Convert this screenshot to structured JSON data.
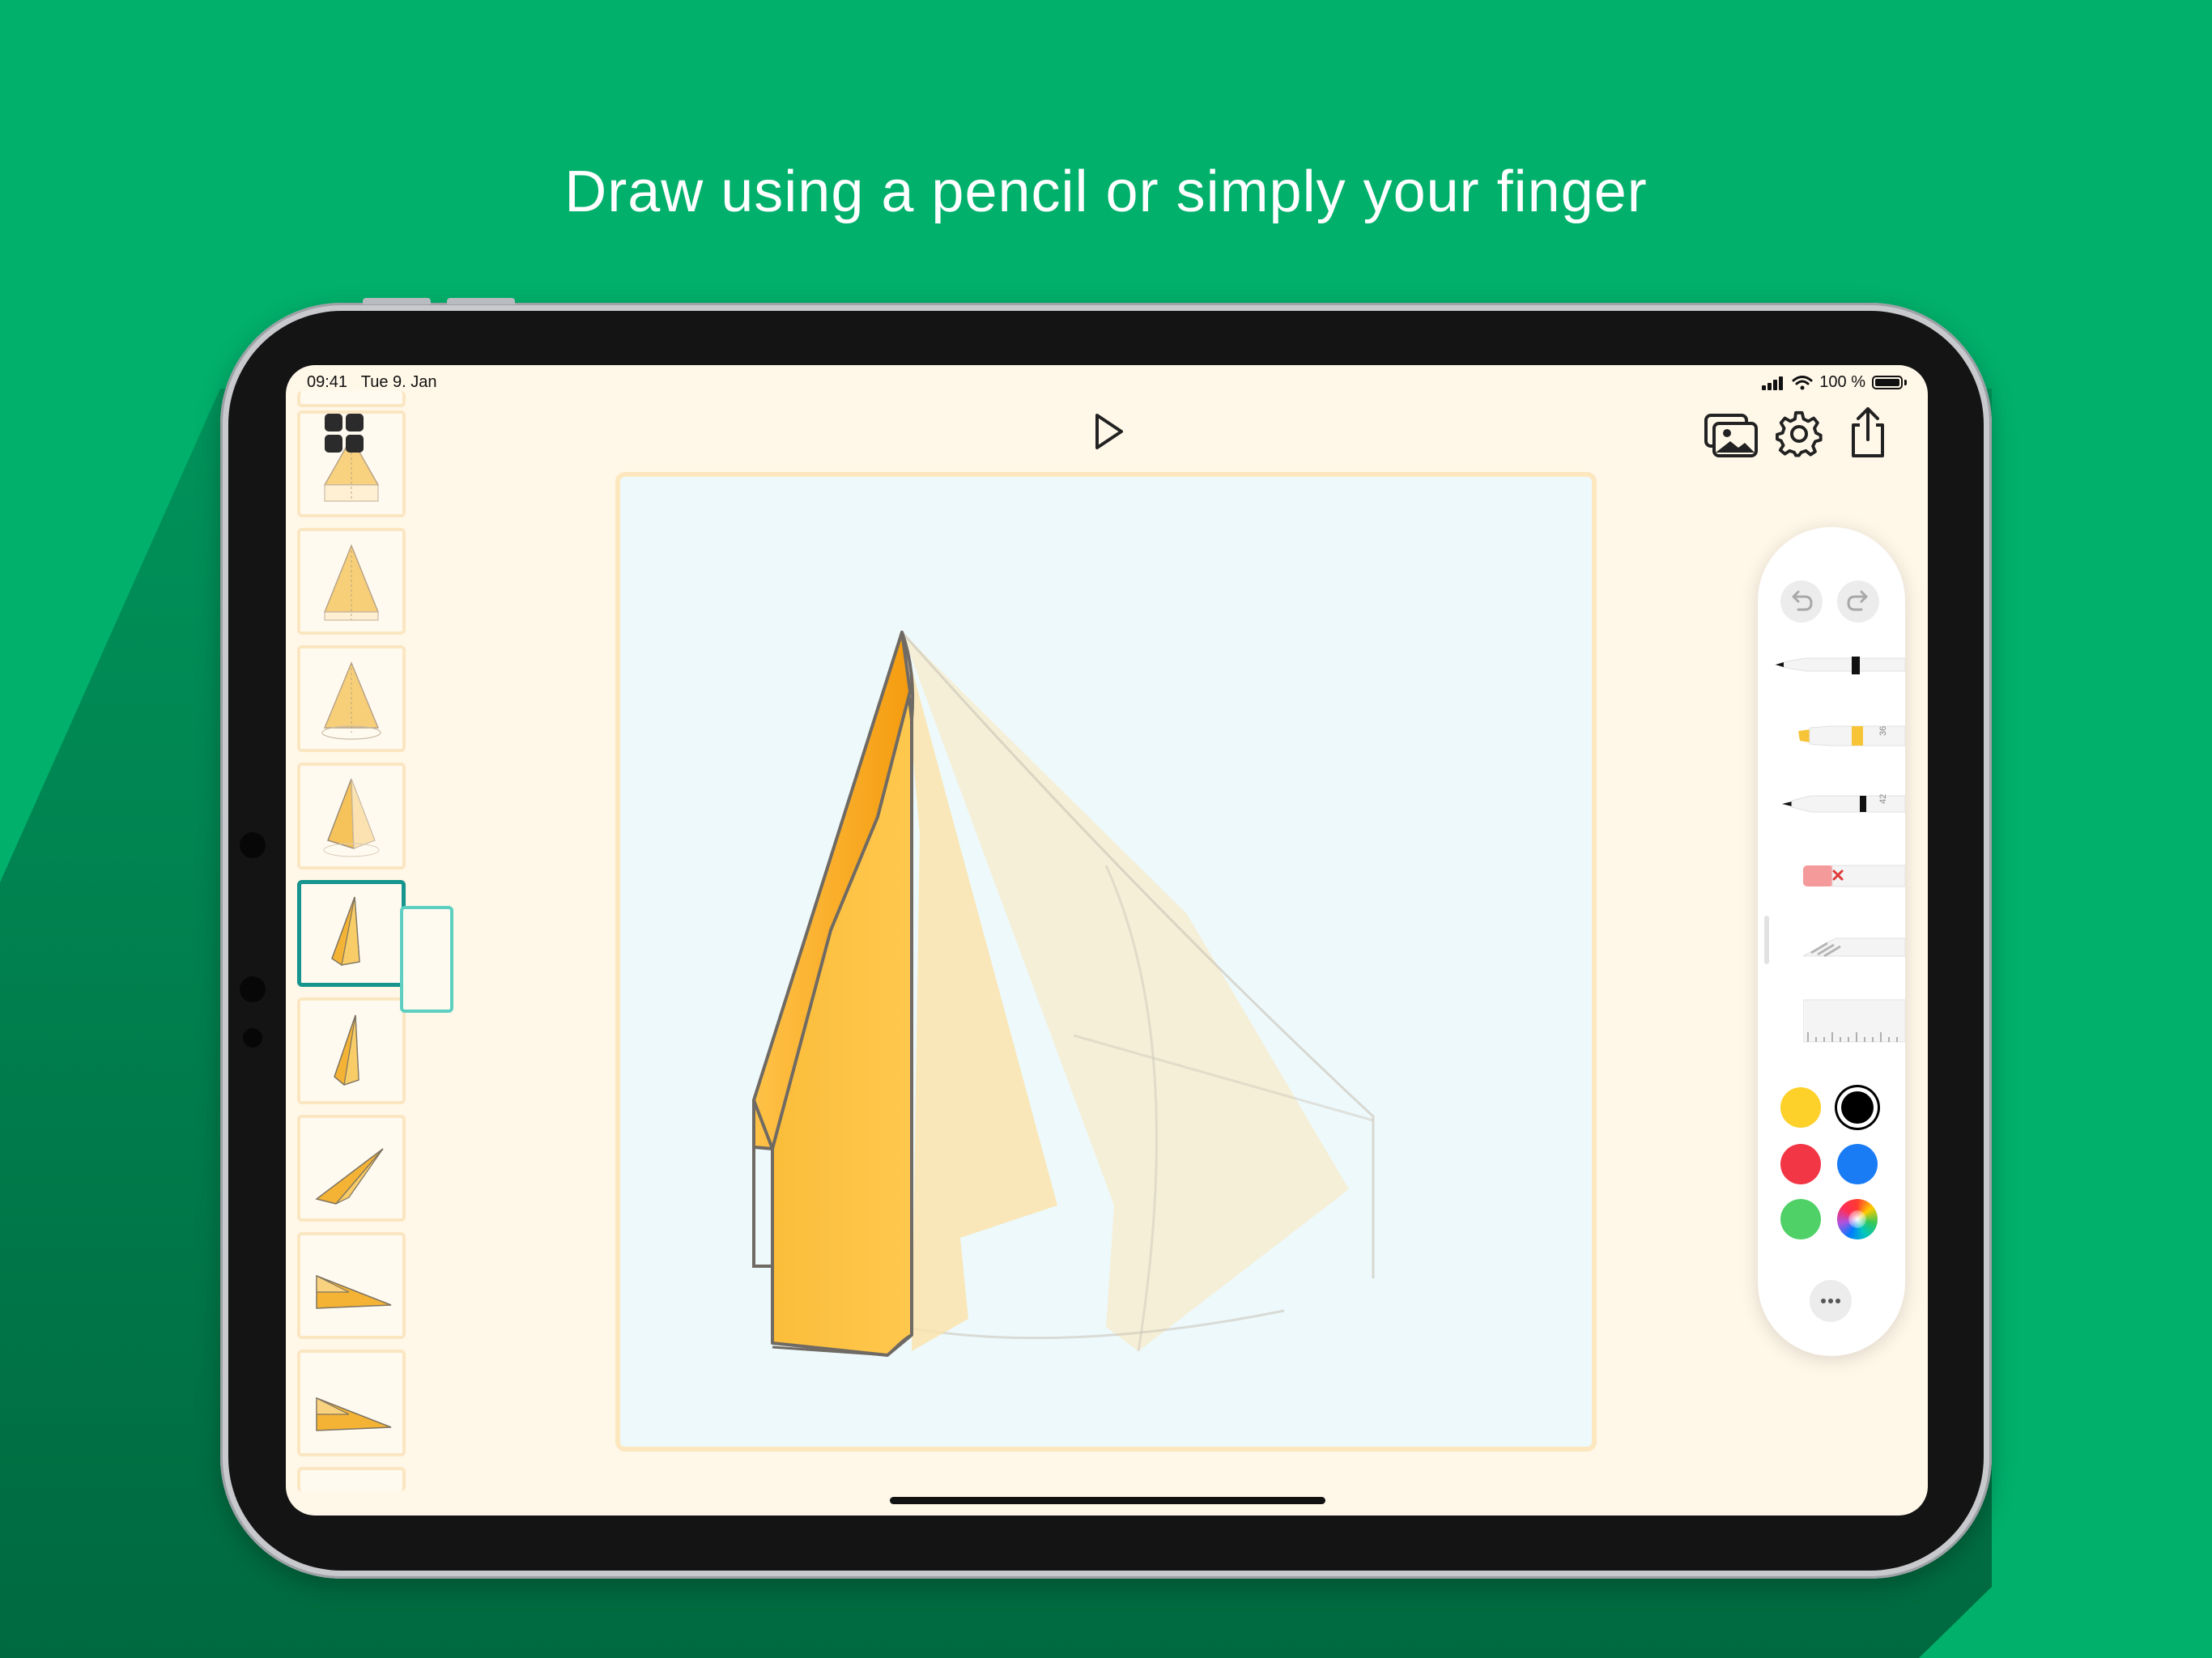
{
  "headline": "Draw using a pencil or simply your finger",
  "status_bar": {
    "time": "09:41",
    "date": "Tue 9. Jan",
    "battery": "100 %"
  },
  "colors": {
    "background": "#00b06b",
    "screen": "#fff7e8",
    "canvas": "#eef9fc",
    "selection": "#16948e",
    "swatch_yellow": "#fdd02a",
    "swatch_black": "#000000",
    "swatch_red": "#f23645",
    "swatch_blue": "#1a7cf5",
    "swatch_green": "#4fd167"
  },
  "toolbar": {
    "grid_icon": "grid-icon",
    "play_icon": "play-icon",
    "gallery_icon": "gallery-icon",
    "settings_icon": "gear-icon",
    "share_icon": "share-icon"
  },
  "filmstrip": {
    "selected_index": 4,
    "frame_count": 9
  },
  "tool_palette": {
    "tools": [
      "pen",
      "marker",
      "pencil",
      "eraser",
      "lasso",
      "ruler"
    ],
    "marker_width": "36",
    "pencil_width": "42",
    "swatches": [
      "yellow",
      "black",
      "red",
      "blue",
      "green",
      "color-picker"
    ],
    "selected_swatch": "black",
    "more_icon": "ellipsis-icon"
  }
}
